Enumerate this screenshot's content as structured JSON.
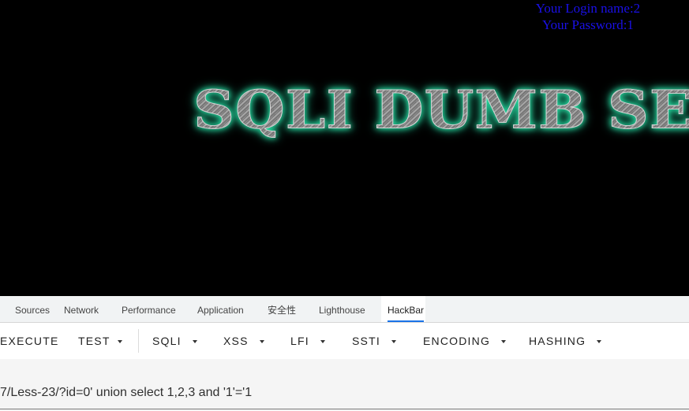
{
  "page": {
    "login_name": "Your Login name:2",
    "password": "Your Password:1",
    "banner_text": "SQLI DUMB SERIES"
  },
  "devtools": {
    "tabs": [
      {
        "label": "Sources"
      },
      {
        "label": "Network"
      },
      {
        "label": "Performance"
      },
      {
        "label": "Application"
      },
      {
        "label": "安全性"
      },
      {
        "label": "Lighthouse"
      },
      {
        "label": "HackBar",
        "active": true
      }
    ],
    "accent_color": "#1a73e8"
  },
  "hackbar": {
    "buttons": [
      {
        "label": "EXECUTE"
      },
      {
        "label": "TEST",
        "dropdown": true
      },
      {
        "label": "SQLI",
        "dropdown": true
      },
      {
        "label": "XSS",
        "dropdown": true
      },
      {
        "label": "LFI",
        "dropdown": true
      },
      {
        "label": "SSTI",
        "dropdown": true
      },
      {
        "label": "ENCODING",
        "dropdown": true
      },
      {
        "label": "HASHING",
        "dropdown": true
      }
    ],
    "url_value": "7/Less-23/?id=0' union select 1,2,3 and '1'='1"
  }
}
